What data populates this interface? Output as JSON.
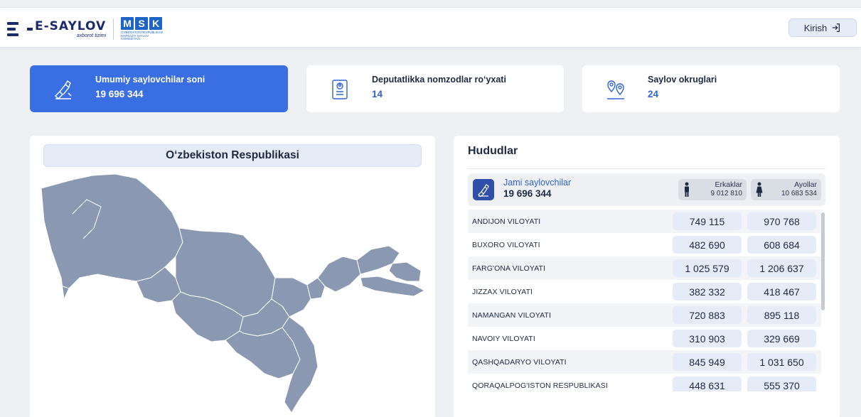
{
  "header": {
    "logo_text": "E-SAYLOV",
    "logo_subtitle": "axborot tizimi",
    "msk_letters": [
      "M",
      "S",
      "K"
    ],
    "msk_subtitle": "O'ZBEKISTON RESPUBLIKASI MARKAZIY SAYLOV KOMISSIYASI",
    "login_label": "Kirish",
    "login_icon": "login-arrow-icon"
  },
  "stats": [
    {
      "label": "Umumiy saylovchilar soni",
      "value": "19 696 344",
      "icon": "voter-hand-icon",
      "active": true
    },
    {
      "label": "Deputatlikka nomzodlar ro‘yxati",
      "value": "14",
      "icon": "candidate-list-icon",
      "active": false
    },
    {
      "label": "Saylov okruglari",
      "value": "24",
      "icon": "map-pin-icon",
      "active": false
    }
  ],
  "map": {
    "title": "O‘zbekiston Respublikasi",
    "fill_color": "#8a99b1",
    "border_color": "#ffffff"
  },
  "regions": {
    "title": "Hududlar",
    "total": {
      "label": "Jami saylovchilar",
      "value": "19 696 344",
      "male_label": "Erkaklar",
      "male_value": "9 012 810",
      "female_label": "Ayollar",
      "female_value": "10 683 534"
    },
    "rows": [
      {
        "name": "ANDIJON VILOYATI",
        "male": "749 115",
        "female": "970 768"
      },
      {
        "name": "BUXORO VILOYATI",
        "male": "482 690",
        "female": "608 684"
      },
      {
        "name": "FARG'ONA VILOYATI",
        "male": "1 025 579",
        "female": "1 206 637"
      },
      {
        "name": "JIZZAX VILOYATI",
        "male": "382 332",
        "female": "418 467"
      },
      {
        "name": "NAMANGAN VILOYATI",
        "male": "720 883",
        "female": "895 118"
      },
      {
        "name": "NAVOIY VILOYATI",
        "male": "310 903",
        "female": "329 669"
      },
      {
        "name": "QASHQADARYO VILOYATI",
        "male": "845 949",
        "female": "1 031 650"
      },
      {
        "name": "QORAQALPOG'ISTON RESPUBLIKASI",
        "male": "448 631",
        "female": "555 370"
      }
    ]
  },
  "colors": {
    "accent": "#3a6fe3",
    "accent_text": "#2f63d6",
    "value_box": "#e6ecf7",
    "dark_text": "#1e2a44"
  }
}
